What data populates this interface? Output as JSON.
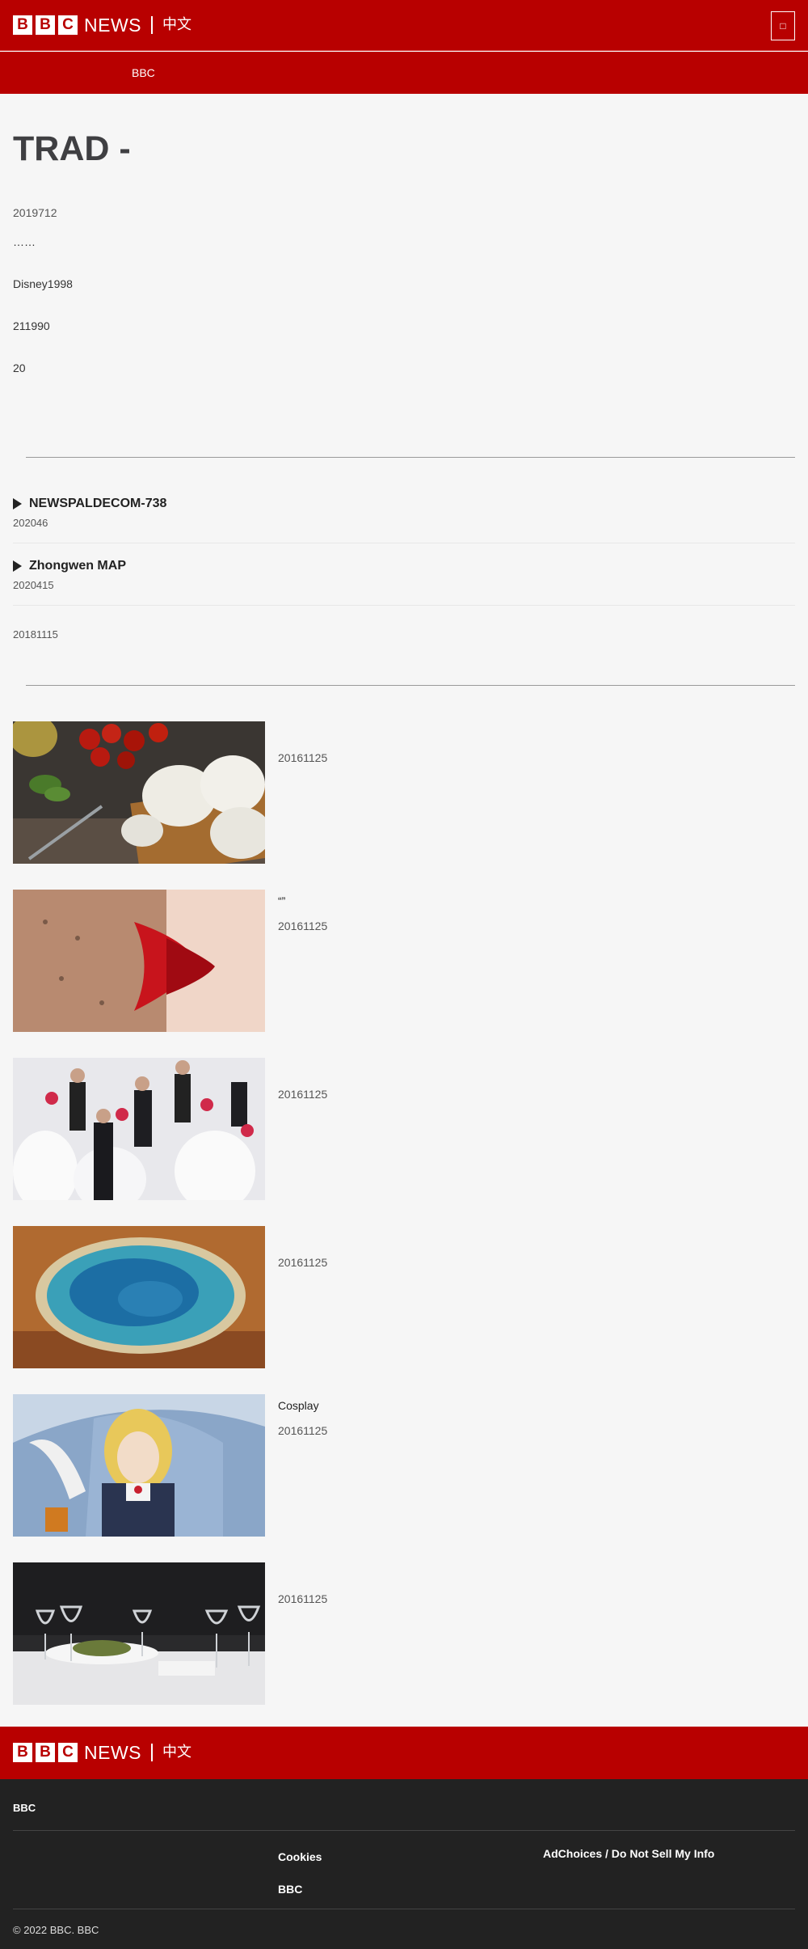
{
  "header": {
    "bbc_letters": [
      "B",
      "B",
      "C"
    ],
    "news_word": "NEWS",
    "language": "中文",
    "menu_icon": "menu-icon"
  },
  "nav": {
    "items": [
      "",
      "",
      "",
      "",
      "",
      "",
      "",
      "BBC"
    ]
  },
  "article": {
    "title": "TRAD - ",
    "date": "2019712",
    "paragraphs": [
      "……",
      "Disney1998",
      "211990",
      "20"
    ]
  },
  "related": {
    "heading": "",
    "items": [
      {
        "title": "NEWSPALDECOM-738",
        "date": "202046",
        "media": "video"
      },
      {
        "title": "Zhongwen MAP",
        "date": "2020415",
        "media": "video"
      },
      {
        "title": "",
        "date": "20181115",
        "media": "text"
      }
    ]
  },
  "top_stories": {
    "heading": "",
    "items": [
      {
        "title": "",
        "date": "20161125",
        "image": "cheese-tomatoes-photo"
      },
      {
        "title": " “”",
        "date": "20161125",
        "image": "kiss-photo"
      },
      {
        "title": " ",
        "date": "20161125",
        "image": "group-wedding-photo"
      },
      {
        "title": "",
        "date": "20161125",
        "image": "hot-spring-photo"
      },
      {
        "title": "Cosplay",
        "date": "20161125",
        "image": "cosplay-photo"
      },
      {
        "title": " ",
        "date": "20161125",
        "image": "restaurant-table-photo"
      }
    ]
  },
  "footer": {
    "heading": "BBC",
    "links_col1": [
      "",
      ""
    ],
    "links_col2": [
      "Cookies",
      "BBC"
    ],
    "links_col3": [
      "AdChoices / Do Not Sell My Info"
    ],
    "copyright": "© 2022 BBC. BBC "
  },
  "colors": {
    "brand_red": "#b80000",
    "footer_dark": "#222222",
    "page_bg": "#f6f6f6"
  }
}
